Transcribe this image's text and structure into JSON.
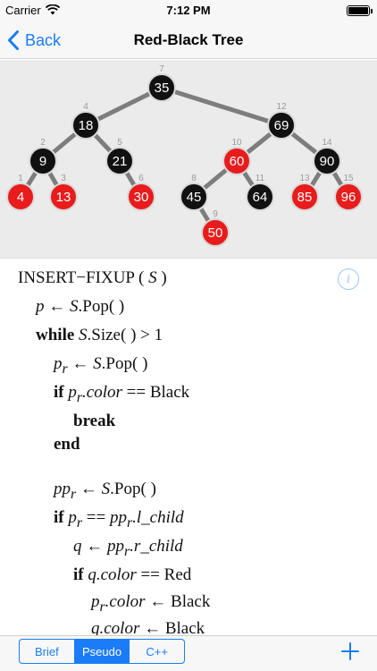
{
  "status_bar": {
    "carrier": "Carrier",
    "time": "7:12 PM"
  },
  "nav": {
    "back_label": "Back",
    "title": "Red-Black Tree"
  },
  "tree": {
    "colors": {
      "red": "#e81c1c",
      "black": "#111111",
      "edge": "#7d7d7d"
    },
    "nodes": [
      {
        "index": "7",
        "key": "35",
        "color": "black"
      },
      {
        "index": "4",
        "key": "18",
        "color": "black"
      },
      {
        "index": "12",
        "key": "69",
        "color": "black"
      },
      {
        "index": "2",
        "key": "9",
        "color": "black"
      },
      {
        "index": "5",
        "key": "21",
        "color": "black"
      },
      {
        "index": "10",
        "key": "60",
        "color": "red"
      },
      {
        "index": "14",
        "key": "90",
        "color": "black"
      },
      {
        "index": "1",
        "key": "4",
        "color": "red"
      },
      {
        "index": "3",
        "key": "13",
        "color": "red"
      },
      {
        "index": "6",
        "key": "30",
        "color": "red"
      },
      {
        "index": "8",
        "key": "45",
        "color": "black"
      },
      {
        "index": "11",
        "key": "64",
        "color": "black"
      },
      {
        "index": "13",
        "key": "85",
        "color": "red"
      },
      {
        "index": "15",
        "key": "96",
        "color": "red"
      },
      {
        "index": "9",
        "key": "50",
        "color": "red"
      }
    ]
  },
  "pseudocode": {
    "header_name": "INSERT−FIXUP",
    "header_open": " ( ",
    "header_arg": "S",
    "header_close": " )",
    "l1_a": "p",
    "l1_b": " ← ",
    "l1_c": "S",
    "l1_d": ".Pop( )",
    "l2_kw": "while",
    "l2_a": " S",
    "l2_b": ".Size( ) > 1",
    "l3_a": "p",
    "l3_sub": "r",
    "l3_b": " ← ",
    "l3_c": "S",
    "l3_d": ".Pop( )",
    "l4_kw": "if",
    "l4_a": " p",
    "l4_sub": "r",
    "l4_b": ".color",
    "l4_c": " == Black",
    "l5_kw": "break",
    "l6_kw": "end",
    "l7_a": "pp",
    "l7_sub": "r",
    "l7_b": " ← ",
    "l7_c": "S",
    "l7_d": ".Pop( )",
    "l8_kw": "if",
    "l8_a": " p",
    "l8_sub": "r",
    "l8_b": " == ",
    "l8_c": "pp",
    "l8_sub2": "r",
    "l8_d": ".l_child",
    "l9_a": "q",
    "l9_b": " ← ",
    "l9_c": "pp",
    "l9_sub": "r",
    "l9_d": ".r_child",
    "l10_kw": "if",
    "l10_a": " q.color",
    "l10_b": " == Red",
    "l11_a": "p",
    "l11_sub": "r",
    "l11_b": ".color",
    "l11_c": " ← Black",
    "l12_a": "q.color",
    "l12_b": " ← Black",
    "info_glyph": "i"
  },
  "toolbar": {
    "tabs": [
      {
        "label": "Brief",
        "active": false
      },
      {
        "label": "Pseudo",
        "active": true
      },
      {
        "label": "C++",
        "active": false
      }
    ]
  }
}
